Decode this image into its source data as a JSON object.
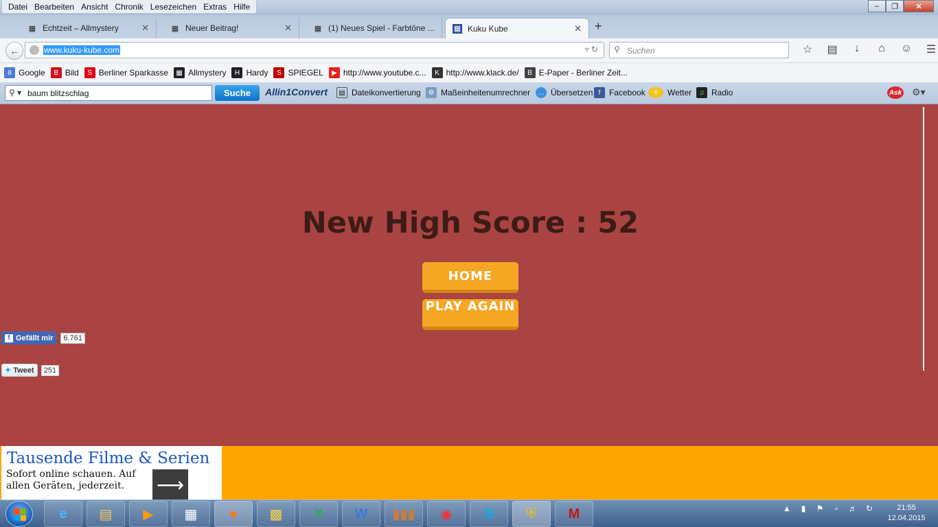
{
  "menu": [
    "Datei",
    "Bearbeiten",
    "Ansicht",
    "Chronik",
    "Lesezeichen",
    "Extras",
    "Hilfe"
  ],
  "tabs": [
    {
      "label": "Echtzeit – Allmystery",
      "icon": "allmystery-icon"
    },
    {
      "label": "Neuer Beitrag!",
      "icon": "allmystery-icon"
    },
    {
      "label": "(1) Neues Spiel - Farbtöne ...",
      "icon": "allmystery-icon"
    },
    {
      "label": "Kuku Kube",
      "icon": "kuku-kube-icon",
      "active": true
    }
  ],
  "url": "www.kuku-kube.com",
  "search": {
    "placeholder": "Suchen"
  },
  "bookmarks": [
    {
      "label": "Google",
      "icon": "google-icon",
      "color": "#4a7bd6"
    },
    {
      "label": "Bild",
      "icon": "bild-icon",
      "color": "#d0111b"
    },
    {
      "label": "Berliner Sparkasse",
      "icon": "sparkasse-icon",
      "color": "#e2001a"
    },
    {
      "label": "Allmystery",
      "icon": "allmystery-icon",
      "color": "#222222"
    },
    {
      "label": "Hardy",
      "icon": "hardy-icon",
      "color": "#222222"
    },
    {
      "label": "SPIEGEL",
      "icon": "spiegel-icon",
      "color": "#c00000"
    },
    {
      "label": "http://www.youtube.c...",
      "icon": "youtube-icon",
      "color": "#e62117"
    },
    {
      "label": "http://www.klack.de/",
      "icon": "klack-icon",
      "color": "#333333"
    },
    {
      "label": "E-Paper - Berliner Zeit...",
      "icon": "berliner-zeitung-icon",
      "color": "#444444"
    }
  ],
  "toolbar": {
    "search_value": "baum blitzschlag",
    "search_button": "Suche",
    "allin_label": "Allin1Convert",
    "items": [
      {
        "label": "Dateikonvertierung",
        "icon": "file-convert-icon"
      },
      {
        "label": "Maßeinheitenumrechner",
        "icon": "units-icon"
      },
      {
        "label": "Übersetzen",
        "icon": "translate-icon"
      },
      {
        "label": "Facebook",
        "icon": "facebook-icon"
      },
      {
        "label": "Wetter",
        "icon": "weather-icon"
      },
      {
        "label": "Radio",
        "icon": "radio-icon"
      }
    ],
    "ask_label": "Ask"
  },
  "game": {
    "heading": "New High Score : 52",
    "home_button": "HOME",
    "play_again_button": "PLAY AGAIN"
  },
  "social": {
    "fb_label": "Gefällt mir",
    "fb_count": "6.761",
    "tweet_label": "Tweet",
    "tweet_count": "251"
  },
  "ad": {
    "title": "Tausende Filme & Serien",
    "text": "Sofort online schauen. Auf allen Geräten, jederzeit."
  },
  "clock": {
    "time": "21:55",
    "date": "12.04.2015"
  },
  "colors": {
    "page_bg": "#a94442",
    "button": "#f5a623",
    "heading": "#3c1c14",
    "ad_bg": "#ffa500"
  }
}
